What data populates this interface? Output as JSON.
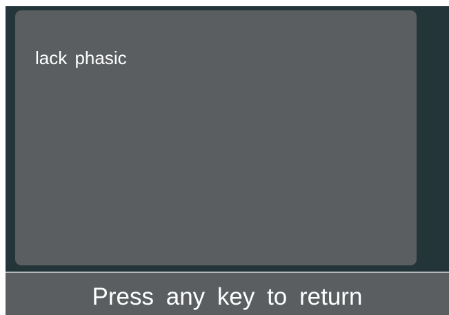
{
  "panel": {
    "text": "lack phasic"
  },
  "footer": {
    "prompt": "Press any key to return"
  },
  "colors": {
    "screen_background": "#24353a",
    "panel_background": "#5a5e60",
    "footer_border": "#b6b9ba",
    "text": "#ffffff"
  }
}
